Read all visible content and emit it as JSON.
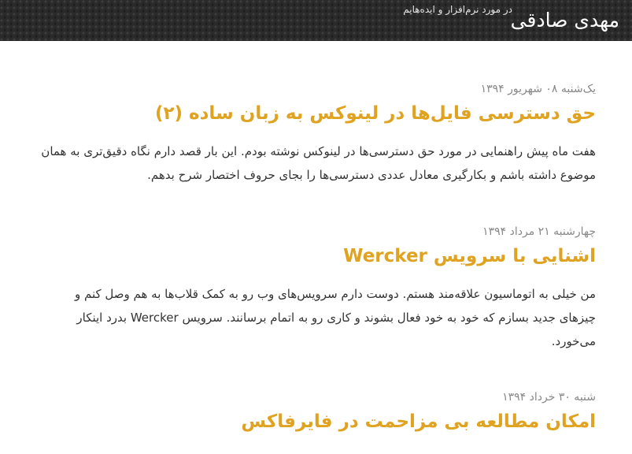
{
  "site": {
    "title": "مهدی صادقی",
    "tagline": "در مورد نرم‌افزار و ایده‌هایم"
  },
  "posts": [
    {
      "date": "یک‌شنبه ۰۸ شهریور ۱۳۹۴",
      "title": "حق دسترسی فایل‌ها در لینوکس به زبان ساده (۲)",
      "excerpt": "هفت ماه پیش راهنمایی در مورد حق دسترسی‌ها در لینوکس نوشته بودم. این بار قصد دارم نگاه دقیق‌تری به همان موضوع داشته باشم و بکارگیری معادل عددی دسترسی‌ها را بجای حروف اختصار شرح بدهم."
    },
    {
      "date": "چهارشنبه ۲۱ مرداد ۱۳۹۴",
      "title": "اشنایی با سرویس Wercker",
      "excerpt": "من خیلی به اتوماسیون علاقه‌مند هستم. دوست دارم سرویس‌های وب رو به کمک قلاب‌ها به هم وصل کنم و چیزهای جدید بسازم که خود به خود فعال بشوند و کاری رو به اتمام برسانند. سرویس Wercker بدرد اینکار می‌خورد."
    },
    {
      "date": "شنبه ۳۰ خرداد ۱۳۹۴",
      "title": "امکان مطالعه بی مزاحمت در فایرفاکس",
      "excerpt": ""
    }
  ]
}
